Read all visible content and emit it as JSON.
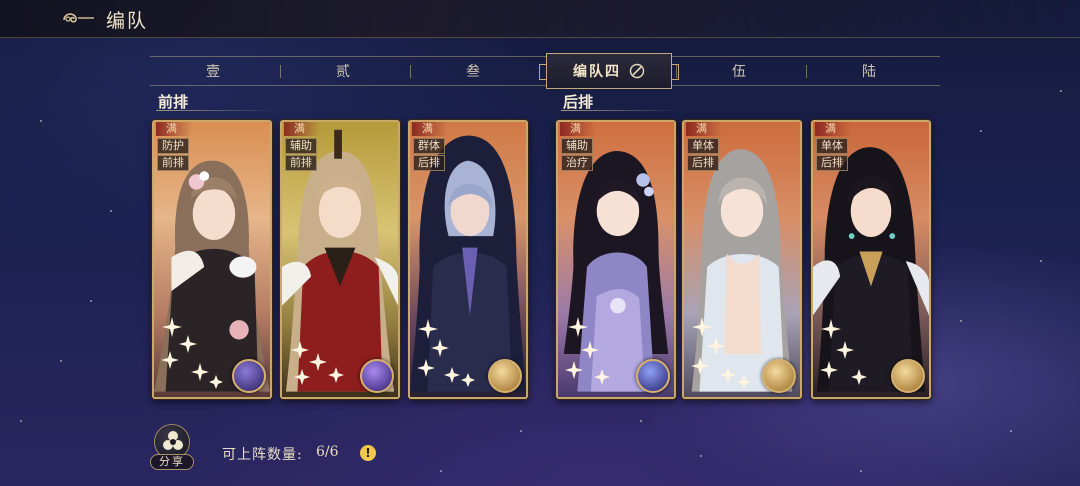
{
  "header": {
    "title": "编队"
  },
  "tabs": [
    {
      "label": "壹",
      "active": false
    },
    {
      "label": "贰",
      "active": false
    },
    {
      "label": "叁",
      "active": false
    },
    {
      "label": "编队四",
      "active": true
    },
    {
      "label": "伍",
      "active": false
    },
    {
      "label": "陆",
      "active": false
    }
  ],
  "rows": {
    "front": "前排",
    "back": "后排"
  },
  "cards": [
    {
      "badge": "满",
      "tags": [
        "防护",
        "前排"
      ],
      "element": "purple-orb-icon"
    },
    {
      "badge": "满",
      "tags": [
        "辅助",
        "前排"
      ],
      "element": "purple-orb-icon"
    },
    {
      "badge": "满",
      "tags": [
        "群体",
        "后排"
      ],
      "element": "gold-orb-icon"
    },
    {
      "badge": "满",
      "tags": [
        "辅助",
        "治疗"
      ],
      "element": "purple-orb-icon"
    },
    {
      "badge": "满",
      "tags": [
        "单体",
        "后排"
      ],
      "element": "gold-orb-icon"
    },
    {
      "badge": "满",
      "tags": [
        "单体",
        "后排"
      ],
      "element": "gold-orb-icon"
    }
  ],
  "footer": {
    "share_label": "分享",
    "count_label": "可上阵数量:",
    "count_value": "6/6"
  },
  "colors": {
    "frame_gold": "#caa86a",
    "accent_red": "#8d2a22",
    "info_yellow": "#f2c94c"
  }
}
